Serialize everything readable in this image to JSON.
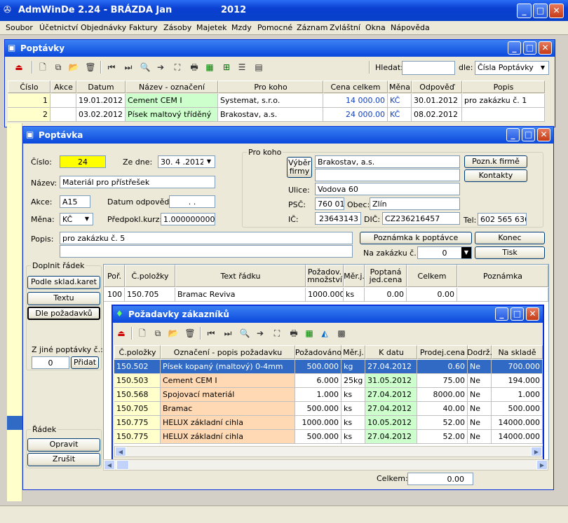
{
  "app": {
    "title": "AdmWinDe 2.24 - BRÁZDA Jan",
    "year": "2012"
  },
  "menu": [
    "Soubor",
    "Účetnictví",
    "Objednávky",
    "Faktury",
    "Zásoby",
    "Majetek",
    "Mzdy",
    "Pomocné",
    "Záznam",
    "Zvláštní",
    "Okna",
    "Nápověda"
  ],
  "poptavky": {
    "title": "Poptávky",
    "search_label": "Hledat:",
    "search_value": "",
    "by_label": "dle:",
    "by_value": "Čísla Poptávky",
    "columns": [
      "Číslo",
      "Akce",
      "Datum",
      "Název - označení",
      "Pro koho",
      "Cena celkem",
      "Měna",
      "Odpověď",
      "Popis"
    ],
    "rows": [
      [
        "1",
        "",
        "19.01.2012",
        "Cement CEM I",
        "Systemat, s.r.o.",
        "14 000.00",
        "KČ",
        "30.01.2012",
        "pro zakázku č. 1"
      ],
      [
        "2",
        "",
        "03.02.2012",
        "Písek maltový tříděný",
        "Brakostav, a.s.",
        "24 000.00",
        "KČ",
        "08.02.2012",
        ""
      ]
    ]
  },
  "poptavka": {
    "title": "Poptávka",
    "cislo_label": "Číslo:",
    "cislo": "24",
    "zedne_label": "Ze dne:",
    "zedne": "30. 4 .2012",
    "nazev_label": "Název:",
    "nazev": "Materiál pro přístřešek",
    "akce_label": "Akce:",
    "akce": "A15",
    "datum_odp_label": "Datum odpovědi:",
    "datum_odp": " .  .",
    "mena_label": "Měna:",
    "mena": "KČ",
    "kurz_label": "Předpokl.kurz:",
    "kurz": "1.000000000",
    "popis_label": "Popis:",
    "popis": "pro zakázku č. 5",
    "popis2": "",
    "prokoho": {
      "group": "Pro koho",
      "vyber": "Výběr firmy",
      "firma": "Brakostav, a.s.",
      "firma2": "",
      "ulice_label": "Ulice:",
      "ulice": "Vodova 60",
      "psc_label": "PSČ:",
      "psc": "760 01",
      "obec_label": "Obec:",
      "obec": "Zlín",
      "ic_label": "IČ:",
      "ic": "23643143",
      "dic_label": "DIČ:",
      "dic": "CZ236216457",
      "tel_label": "Tel:",
      "tel": "602 565 636",
      "pozn_firme": "Pozn.k firmě",
      "kontakty": "Kontakty"
    },
    "pozn_poptavce": "Poznámka k poptávce",
    "zakazka_label": "Na zakázku č.:",
    "zakazka": "0",
    "konec": "Konec",
    "tisk": "Tisk",
    "doplnit": {
      "group": "Doplnit řádek",
      "podle": "Podle sklad.karet",
      "textu": "Textu",
      "dle": "Dle požadavků",
      "zjine_label": "Z jiné poptávky č.:",
      "zjine": "0",
      "pridat": "Přidat"
    },
    "radek": {
      "group": "Řádek",
      "opravit": "Opravit",
      "zrusit": "Zrušit"
    },
    "columns": [
      "Poř.",
      "Č.položky",
      "Text řádku",
      "Požadov. množství",
      "Měr.j.",
      "Poptaná jed.cena",
      "Celkem",
      "Poznámka"
    ],
    "rows": [
      [
        "100",
        "150.705",
        "Bramac Reviva",
        "1000.000",
        "ks",
        "0.00",
        "0.00",
        ""
      ]
    ],
    "celkem_label": "Celkem:",
    "celkem": "0.00"
  },
  "pozadavky": {
    "title": "Požadavky zákazníků",
    "columns": [
      "Č.položky",
      "Označení - popis požadavku",
      "Požadováno",
      "Měr.j.",
      "K datu",
      "Prodej.cena",
      "Dodrž.",
      "Na skladě"
    ],
    "rows": [
      [
        "150.502",
        "Písek kopaný (maltový) 0-4mm",
        "500.000",
        "kg",
        "27.04.2012",
        "0.60",
        "Ne",
        "700.000"
      ],
      [
        "150.503",
        "Cement CEM I",
        "6.000",
        "25kg",
        "31.05.2012",
        "75.00",
        "Ne",
        "194.000"
      ],
      [
        "150.568",
        "Spojovací materiál",
        "1.000",
        "ks",
        "27.04.2012",
        "8000.00",
        "Ne",
        "1.000"
      ],
      [
        "150.705",
        "Bramac",
        "500.000",
        "ks",
        "27.04.2012",
        "40.00",
        "Ne",
        "500.000"
      ],
      [
        "150.775",
        "HELUX základní cihla",
        "1000.000",
        "ks",
        "10.05.2012",
        "52.00",
        "Ne",
        "14000.000"
      ],
      [
        "150.775",
        "HELUX základní cihla",
        "500.000",
        "ks",
        "27.04.2012",
        "52.00",
        "Ne",
        "14000.000"
      ]
    ]
  },
  "colors": {
    "yellow": "#ffff00",
    "green_cell": "#ccffcc",
    "salmon": "#ffd9b3",
    "selected": "#316ac5",
    "row_yellow": "#ffffcc"
  }
}
